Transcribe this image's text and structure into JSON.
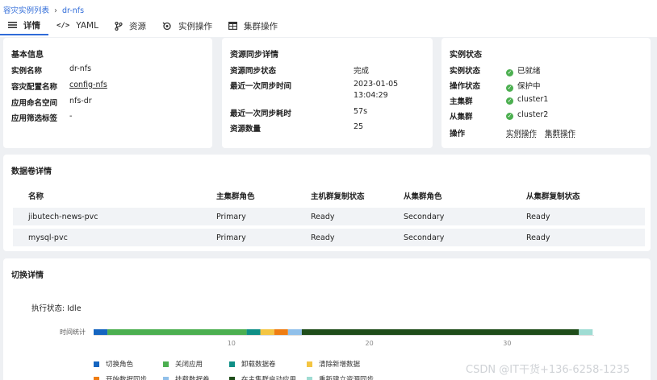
{
  "breadcrumb": {
    "parent": "容灾实例列表",
    "current": "dr-nfs"
  },
  "tabs": [
    {
      "label": "详情",
      "icon": "list-icon"
    },
    {
      "label": "YAML",
      "icon": "code-icon"
    },
    {
      "label": "资源",
      "icon": "branch-icon"
    },
    {
      "label": "实例操作",
      "icon": "settings-icon"
    },
    {
      "label": "集群操作",
      "icon": "table-icon"
    }
  ],
  "basic": {
    "title": "基本信息",
    "rows": [
      {
        "k": "实例名称",
        "v": "dr-nfs"
      },
      {
        "k": "容灾配置名称",
        "v": "config-nfs"
      },
      {
        "k": "应用命名空间",
        "v": "nfs-dr"
      },
      {
        "k": "应用筛选标签",
        "v": "-"
      }
    ]
  },
  "sync": {
    "title": "资源同步详情",
    "rows": [
      {
        "k": "资源同步状态",
        "v": "完成"
      },
      {
        "k": "最近一次同步时间",
        "v": "2023-01-05",
        "v2": "13:04:29"
      },
      {
        "k": "最近一次同步耗时",
        "v": "57s"
      },
      {
        "k": "资源数量",
        "v": "25"
      }
    ]
  },
  "status": {
    "title": "实例状态",
    "rows": [
      {
        "k": "实例状态",
        "v": "已就绪"
      },
      {
        "k": "操作状态",
        "v": "保护中"
      },
      {
        "k": "主集群",
        "v": "cluster1"
      },
      {
        "k": "从集群",
        "v": "cluster2"
      }
    ],
    "ops_label": "操作",
    "ops": [
      "实例操作",
      "集群操作"
    ],
    "color_ok": "#4caf50"
  },
  "volumes": {
    "title": "数据卷详情",
    "headers": [
      "名称",
      "主集群角色",
      "主机群复制状态",
      "从集群角色",
      "从集群复制状态"
    ],
    "rows": [
      [
        "jibutech-news-pvc",
        "Primary",
        "Ready",
        "Secondary",
        "Ready"
      ],
      [
        "mysql-pvc",
        "Primary",
        "Ready",
        "Secondary",
        "Ready"
      ]
    ]
  },
  "switch": {
    "title": "切换详情",
    "exec_status": "执行状态: Idle"
  },
  "chart_data": {
    "type": "bar",
    "orientation": "horizontal-stacked",
    "category": "时间统计",
    "x_ticks": [
      10,
      20,
      30
    ],
    "xlim": [
      0,
      36.3
    ],
    "segments": [
      {
        "name": "切换角色",
        "value": 1.0,
        "color": "#1565c0"
      },
      {
        "name": "关闭应用",
        "value": 10.1,
        "color": "#4caf50"
      },
      {
        "name": "卸载数据卷",
        "value": 1.0,
        "color": "#0f8f86"
      },
      {
        "name": "清除新增数据",
        "value": 1.0,
        "color": "#f4c542"
      },
      {
        "name": "开始数据同步",
        "value": 1.0,
        "color": "#ef7d12"
      },
      {
        "name": "挂载数据卷",
        "value": 1.0,
        "color": "#90c0ea"
      },
      {
        "name": "在主集群启动应用",
        "value": 20.1,
        "color": "#1f4d1a"
      },
      {
        "name": "重新建立资源同步",
        "value": 1.0,
        "color": "#9fdcd3"
      }
    ]
  },
  "watermark": "CSDN @IT干货+136-6258-1235"
}
